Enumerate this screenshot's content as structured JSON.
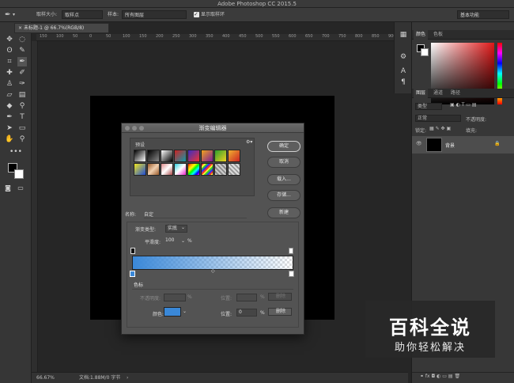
{
  "app": {
    "title": "Adobe Photoshop CC 2015.5"
  },
  "options_bar": {
    "sample_size_label": "取样大小:",
    "sample_size_value": "取样点",
    "sample_label": "样本:",
    "sample_value": "所有图层",
    "show_ring_label": "显示取样环",
    "workspace_value": "基本功能"
  },
  "document": {
    "tab_title": "未标题-1 @ 66.7%(RGB/8)",
    "ruler_numbers": [
      "150",
      "100",
      "50",
      "0",
      "50",
      "100",
      "150",
      "200",
      "250",
      "300",
      "350",
      "400",
      "450",
      "500",
      "550",
      "600",
      "650",
      "700",
      "750",
      "800",
      "850",
      "900"
    ]
  },
  "status": {
    "zoom": "66.67%",
    "doc_info": "文档:1.88M/0 字节"
  },
  "panels": {
    "color_tabs": [
      "颜色",
      "色板"
    ],
    "layers_tabs": [
      "图层",
      "通道",
      "路径"
    ],
    "layers_kind": "类型",
    "blend_mode": "正常",
    "opacity_label": "不透明度:",
    "lock_label": "锁定:",
    "fill_label": "填充:",
    "layer_name": "背景"
  },
  "dialog": {
    "title": "渐变编辑器",
    "presets_label": "预设",
    "ok": "确定",
    "cancel": "取消",
    "load": "载入...",
    "save": "存储...",
    "name_label": "名称:",
    "name_value": "自定",
    "new": "新建",
    "gradient_type_label": "渐变类型:",
    "gradient_type_value": "实底",
    "smoothness_label": "平滑度:",
    "smoothness_value": "100",
    "smoothness_unit": "%",
    "stops_label": "色标",
    "opacity_label": "不透明度:",
    "opacity_unit": "%",
    "position_label": "位置:",
    "position_unit": "%",
    "delete_label": "删除",
    "color_label": "颜色:",
    "color_position_value": "0",
    "stop_color": "#3a88d8"
  },
  "watermark": {
    "title": "百科全说",
    "subtitle": "助你轻松解决"
  }
}
